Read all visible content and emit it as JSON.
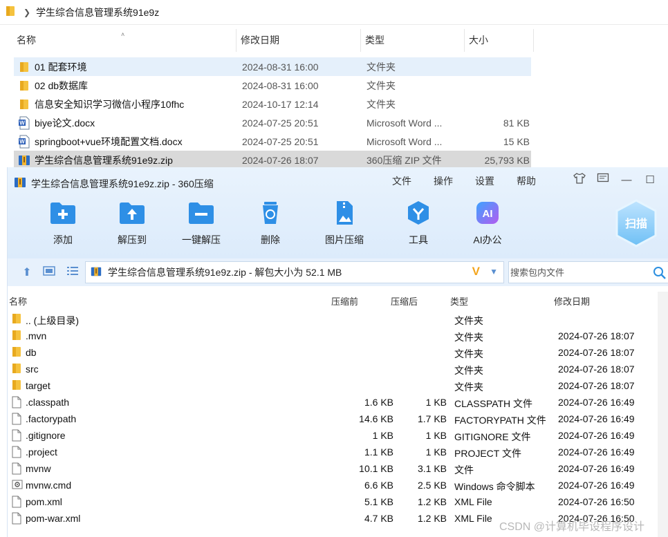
{
  "explorer": {
    "breadcrumb": "学生综合信息管理系统91e9z",
    "columns": {
      "name": "名称",
      "modified": "修改日期",
      "type": "类型",
      "size": "大小"
    },
    "rows": [
      {
        "name": "01 配套环境",
        "date": "2024-08-31 16:00",
        "type": "文件夹",
        "size": "",
        "icon": "folder-icon"
      },
      {
        "name": "02 db数据库",
        "date": "2024-08-31 16:00",
        "type": "文件夹",
        "size": "",
        "icon": "folder-icon"
      },
      {
        "name": "信息安全知识学习微信小程序10fhc",
        "date": "2024-10-17 12:14",
        "type": "文件夹",
        "size": "",
        "icon": "folder-icon"
      },
      {
        "name": "biye论文.docx",
        "date": "2024-07-25 20:51",
        "type": "Microsoft Word ...",
        "size": "81 KB",
        "icon": "word-doc-icon"
      },
      {
        "name": "springboot+vue环境配置文档.docx",
        "date": "2024-07-25 20:51",
        "type": "Microsoft Word ...",
        "size": "15 KB",
        "icon": "word-doc-icon"
      },
      {
        "name": "学生综合信息管理系统91e9z.zip",
        "date": "2024-07-26 18:07",
        "type": "360压缩 ZIP 文件",
        "size": "25,793 KB",
        "icon": "zip-archive-icon"
      }
    ]
  },
  "zip": {
    "title": "学生综合信息管理系统91e9z.zip - 360压缩",
    "menu": [
      "文件",
      "操作",
      "设置",
      "帮助"
    ],
    "tools": [
      {
        "label": "添加",
        "icon": "add-folder-icon"
      },
      {
        "label": "解压到",
        "icon": "extract-to-icon"
      },
      {
        "label": "一键解压",
        "icon": "one-click-extract-icon"
      },
      {
        "label": "删除",
        "icon": "recycle-bin-icon"
      },
      {
        "label": "图片压缩",
        "icon": "image-compress-icon"
      },
      {
        "label": "工具",
        "icon": "tools-icon"
      },
      {
        "label": "AI办公",
        "icon": "ai-office-icon"
      }
    ],
    "scan_label": "扫描",
    "address": "学生综合信息管理系统91e9z.zip - 解包大小为 52.1 MB",
    "search_placeholder": "搜索包内文件",
    "columns": {
      "name": "名称",
      "before": "压缩前",
      "after": "压缩后",
      "type": "类型",
      "modified": "修改日期"
    },
    "rows": [
      {
        "name": ".. (上级目录)",
        "before": "",
        "after": "",
        "type": "文件夹",
        "date": "",
        "icon": "folder-icon"
      },
      {
        "name": ".mvn",
        "before": "",
        "after": "",
        "type": "文件夹",
        "date": "2024-07-26 18:07",
        "icon": "folder-icon"
      },
      {
        "name": "db",
        "before": "",
        "after": "",
        "type": "文件夹",
        "date": "2024-07-26 18:07",
        "icon": "folder-icon"
      },
      {
        "name": "src",
        "before": "",
        "after": "",
        "type": "文件夹",
        "date": "2024-07-26 18:07",
        "icon": "folder-icon"
      },
      {
        "name": "target",
        "before": "",
        "after": "",
        "type": "文件夹",
        "date": "2024-07-26 18:07",
        "icon": "folder-icon"
      },
      {
        "name": ".classpath",
        "before": "1.6 KB",
        "after": "1 KB",
        "type": "CLASSPATH 文件",
        "date": "2024-07-26 16:49",
        "icon": "file-icon"
      },
      {
        "name": ".factorypath",
        "before": "14.6 KB",
        "after": "1.7 KB",
        "type": "FACTORYPATH 文件",
        "date": "2024-07-26 16:49",
        "icon": "file-icon"
      },
      {
        "name": ".gitignore",
        "before": "1 KB",
        "after": "1 KB",
        "type": "GITIGNORE 文件",
        "date": "2024-07-26 16:49",
        "icon": "file-icon"
      },
      {
        "name": ".project",
        "before": "1.1 KB",
        "after": "1 KB",
        "type": "PROJECT 文件",
        "date": "2024-07-26 16:49",
        "icon": "file-icon"
      },
      {
        "name": "mvnw",
        "before": "10.1 KB",
        "after": "3.1 KB",
        "type": "文件",
        "date": "2024-07-26 16:49",
        "icon": "file-icon"
      },
      {
        "name": "mvnw.cmd",
        "before": "6.6 KB",
        "after": "2.5 KB",
        "type": "Windows 命令脚本",
        "date": "2024-07-26 16:49",
        "icon": "cmd-script-icon"
      },
      {
        "name": "pom.xml",
        "before": "5.1 KB",
        "after": "1.2 KB",
        "type": "XML File",
        "date": "2024-07-26 16:50",
        "icon": "file-icon"
      },
      {
        "name": "pom-war.xml",
        "before": "4.7 KB",
        "after": "1.2 KB",
        "type": "XML File",
        "date": "2024-07-26 16:50",
        "icon": "file-icon"
      }
    ]
  },
  "watermark": "CSDN @计算机毕设程序设计",
  "colors": {
    "accent": "#2b8fe0",
    "folder": "#f5c23e",
    "selection": "#d9d9d9",
    "hover": "#e5f0fb"
  }
}
